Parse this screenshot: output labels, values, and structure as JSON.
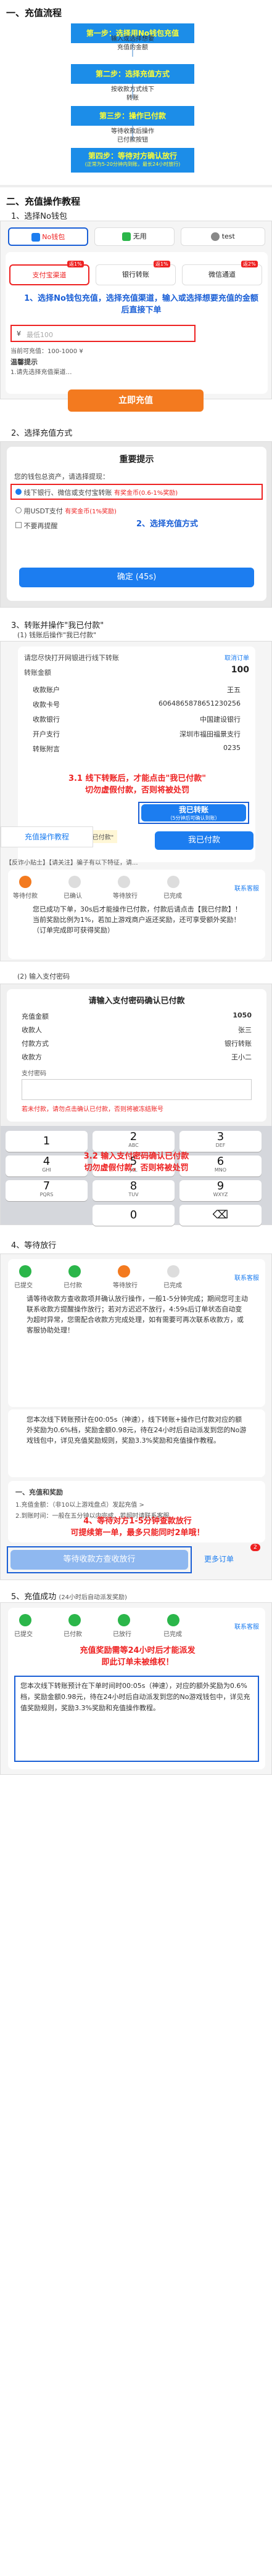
{
  "section1": {
    "title": "一、充值流程",
    "step1": "第一步：选择用No钱包充值",
    "note1": "输入或选择想要\n充值的金额",
    "step2": "第二步：选择充值方式",
    "note2": "按收款方式线下\n转账",
    "step3": "第三步：操作已付款",
    "note3": "等待收款后操作\n已付款按钮",
    "step4a": "第四步：等待对方确认放行",
    "step4b": "(正常为5-20分钟内到账，最长24小时放行)"
  },
  "section2": {
    "title": "二、充值操作教程",
    "sub1": "1、选择No钱包",
    "tabs": [
      "No钱包",
      "无用",
      "test"
    ],
    "channels": [
      "支付宝渠道",
      "银行转账",
      "微信通道"
    ],
    "channel_badges": [
      "返1%",
      "返1%",
      "返2%"
    ],
    "amount_prefix": "¥",
    "amount_placeholder": "最低100",
    "amount_hint": "当前可充值：100-1000 ¥",
    "rules_title": "温馨提示",
    "rules_text": "1.请先选择充值渠道…",
    "note1": "1、选择No钱包充值，选择充值渠道，输入或选择想要充值的金额后直接下单",
    "recharge_btn": "立即充值",
    "sub2": "2、选择充值方式",
    "dialog_title": "重要提示",
    "dialog_warn": "您的钱包总资产，请选择提现：",
    "opt1": "线下银行、微信或支付宝转账",
    "opt1_tag": "有奖金币(0.6-1%奖励)",
    "opt2": "用USDT支付",
    "opt2_tag": "有奖金币(1%奖励)",
    "opt3": "不要再提醒",
    "note2": "2、选择充值方式",
    "confirm_btn": "确定 (45s)",
    "sub3": "3、转账并操作\"我已付款\"",
    "sub3a": "(1) 钱账后操作\"我已付款\"",
    "bank_hint": "请您尽快打开网银进行线下转账",
    "bank_hint_link": "取消订单",
    "transfer_label": "转账金额",
    "transfer_amount": "100",
    "bank_rows": [
      {
        "k": "收款账户",
        "v": "王五"
      },
      {
        "k": "收款卡号",
        "v": "6064865878651230256"
      },
      {
        "k": "收款银行",
        "v": "中国建设银行"
      },
      {
        "k": "开户支行",
        "v": "深圳市福田福景支行"
      },
      {
        "k": "转账附言",
        "v": "0235"
      }
    ],
    "note3": "3.1 线下转账后，才能点击\"我已付款\"\n切勿虚假付款，否则将被处罚",
    "paid_btn_title": "我已转账",
    "paid_btn_sub": "（5分钟后可确认到账）",
    "tip_bar": "请务必在转账后点击\"我已付款\"",
    "left_tab": "充值操作教程",
    "trans_btn": "我已付款",
    "ad_line": "【反诈小贴士】【请关注】骗子有以下特征，请...",
    "track_steps": [
      "等待付款",
      "已确认",
      "等待放行",
      "已完成"
    ],
    "contact": "联系客服",
    "success_text": "您已成功下单，30s后才能操作已付款，付款后请点击【我已付款】！当前奖励比例为1%，若加上游戏商户返还奖励，还可享受额外奖励！（订单完成即可获得奖励）",
    "sub3b": "(2) 输入支付密码",
    "pwd_dialog_title": "请输入支付密码确认已付款",
    "pay_rows": [
      {
        "k": "充值金额",
        "v": "1050"
      },
      {
        "k": "收款人",
        "v": "张三"
      },
      {
        "k": "付款方式",
        "v": "银行转账"
      },
      {
        "k": "收款方",
        "v": "王小二"
      }
    ],
    "pwd_label": "支付密码",
    "pwd_warn": "若未付款，请勿点击确认已付款，否则将被冻结账号",
    "note4": "3.2 输入支付密码确认已付款\n切勿虚假付款，否则将被处罚",
    "keys": [
      {
        "n": "1",
        "s": ""
      },
      {
        "n": "2",
        "s": "ABC"
      },
      {
        "n": "3",
        "s": "DEF"
      },
      {
        "n": "4",
        "s": "GHI"
      },
      {
        "n": "5",
        "s": "JKL"
      },
      {
        "n": "6",
        "s": "MNO"
      },
      {
        "n": "7",
        "s": "PQRS"
      },
      {
        "n": "8",
        "s": "TUV"
      },
      {
        "n": "9",
        "s": "WXYZ"
      },
      {
        "n": "",
        "s": ""
      },
      {
        "n": "0",
        "s": ""
      },
      {
        "n": "⌫",
        "s": ""
      }
    ]
  },
  "section4": {
    "title": "4、等待放行",
    "track_steps": [
      "已提交",
      "已付款",
      "等待放行",
      "已完成"
    ],
    "contact": "联系客服",
    "wait_text": "请等待收款方查收款项并确认放行操作，一般1-5分钟完成；期间您可主动联系收款方提醒操作放行；若对方迟迟不放行，4:59s后订单状态自动变为超时异常，您需配合收款方完成处理，如有需要可再次联系收款方，或客服协助处理！",
    "reward_text": "您本次线下转账预计在00:05s（神速），线下转账+操作已付款对应的额外奖励为0.6%档，奖励金额0.98元，待在24小时后自动派发到您的No游戏钱包中，详见充值奖励规则，奖励3.3%奖励和充值操作教程。",
    "recharge_rule_title": "一、充值和奖励",
    "rule_line": "1.充值金额：（非10以上游戏盘点）发起充值 >",
    "rule_line2": "2.到账时间：一般在五分钟以内完成，若超时请联系客服",
    "note5": "4、等待对方1-5分钟查款放行\n可提续第一单，最多只能同时2单哦！",
    "wait_btn": "等待收款方查收放行",
    "more_btn": "更多订单",
    "count_badge": "2"
  },
  "section5": {
    "title": "5、充值成功",
    "title_sub": "(24小时后自动派发奖励)",
    "track_steps": [
      "已提交",
      "已付款",
      "已放行",
      "已完成"
    ],
    "contact": "联系客服",
    "note6": "充值奖励需等24小时后才能派发\n即此订单未被维权！",
    "done_text": "您本次线下转账预计在下单时间时00:05s（神速），对应的额外奖励为0.6%档，奖励金额0.98元，待在24小时后自动派发到您的No游戏钱包中，详见充值奖励规则，奖励3.3%奖励和充值操作教程。"
  }
}
